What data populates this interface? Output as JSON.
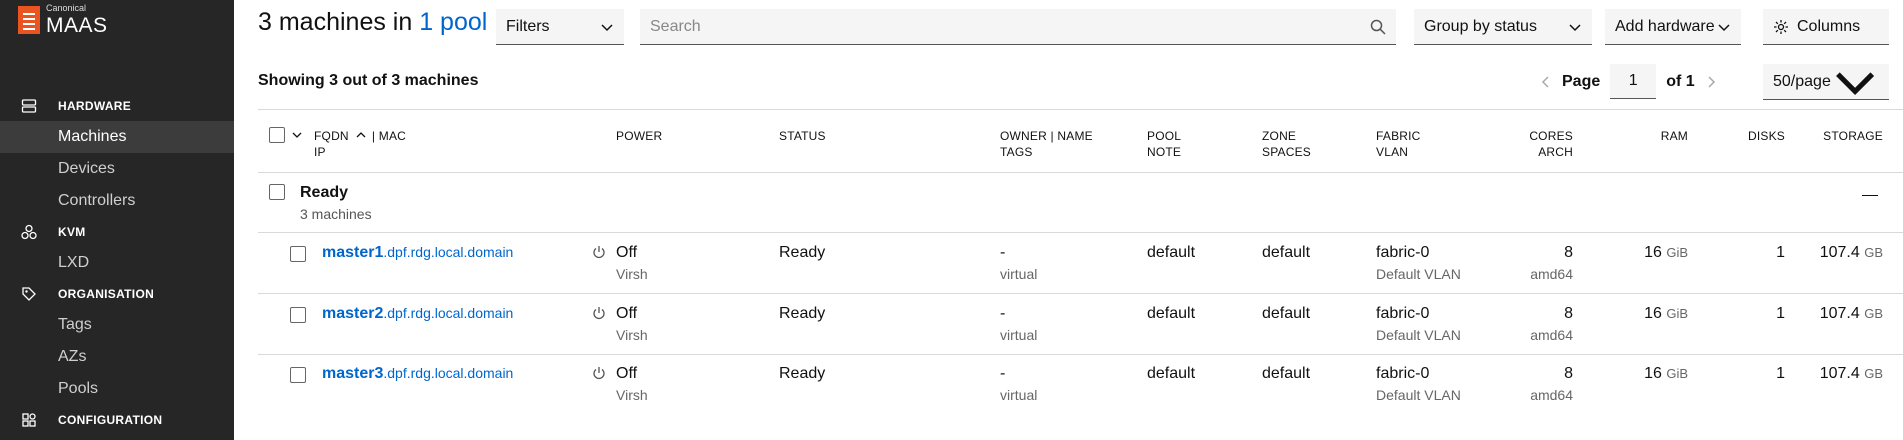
{
  "brand": {
    "small": "Canonical",
    "name": "MAAS"
  },
  "sidebar": {
    "sections": [
      {
        "heading": "HARDWARE",
        "icon": "server-icon",
        "items": [
          {
            "label": "Machines",
            "active": true
          },
          {
            "label": "Devices"
          },
          {
            "label": "Controllers"
          }
        ]
      },
      {
        "heading": "KVM",
        "icon": "kvm-icon",
        "items": [
          {
            "label": "LXD"
          }
        ]
      },
      {
        "heading": "ORGANISATION",
        "icon": "tag-icon",
        "items": [
          {
            "label": "Tags"
          },
          {
            "label": "AZs"
          },
          {
            "label": "Pools"
          }
        ]
      },
      {
        "heading": "CONFIGURATION",
        "icon": "configuration-icon",
        "items": []
      }
    ]
  },
  "header": {
    "title_prefix": "3 machines in ",
    "title_link": "1 pool",
    "filters_label": "Filters",
    "search_placeholder": "Search",
    "group_by_label": "Group by status",
    "add_hardware_label": "Add hardware",
    "columns_label": "Columns"
  },
  "summary": {
    "showing": "Showing 3 out of 3 machines",
    "page_label": "Page",
    "page_value": "1",
    "page_of": "of 1",
    "per_page": "50/page"
  },
  "table": {
    "headers": {
      "fqdn": "FQDN",
      "mac": "| MAC",
      "ip": "IP",
      "power": "POWER",
      "status": "STATUS",
      "owner": "OWNER | NAME",
      "tags": "TAGS",
      "pool": "POOL",
      "note": "NOTE",
      "zone": "ZONE",
      "spaces": "SPACES",
      "fabric": "FABRIC",
      "vlan": "VLAN",
      "cores": "CORES",
      "arch": "ARCH",
      "ram": "RAM",
      "disks": "DISKS",
      "storage": "STORAGE"
    },
    "group": {
      "title": "Ready",
      "count": "3 machines"
    },
    "rows": [
      {
        "host": "master1",
        "domain": ".dpf.rdg.local.domain",
        "power": "Off",
        "power_type": "Virsh",
        "status": "Ready",
        "owner": "-",
        "tags": "virtual",
        "pool": "default",
        "zone": "default",
        "fabric": "fabric-0",
        "vlan": "Default VLAN",
        "cores": "8",
        "arch": "amd64",
        "ram": "16",
        "ram_unit": "GiB",
        "disks": "1",
        "storage": "107.4",
        "storage_unit": "GB"
      },
      {
        "host": "master2",
        "domain": ".dpf.rdg.local.domain",
        "power": "Off",
        "power_type": "Virsh",
        "status": "Ready",
        "owner": "-",
        "tags": "virtual",
        "pool": "default",
        "zone": "default",
        "fabric": "fabric-0",
        "vlan": "Default VLAN",
        "cores": "8",
        "arch": "amd64",
        "ram": "16",
        "ram_unit": "GiB",
        "disks": "1",
        "storage": "107.4",
        "storage_unit": "GB"
      },
      {
        "host": "master3",
        "domain": ".dpf.rdg.local.domain",
        "power": "Off",
        "power_type": "Virsh",
        "status": "Ready",
        "owner": "-",
        "tags": "virtual",
        "pool": "default",
        "zone": "default",
        "fabric": "fabric-0",
        "vlan": "Default VLAN",
        "cores": "8",
        "arch": "amd64",
        "ram": "16",
        "ram_unit": "GiB",
        "disks": "1",
        "storage": "107.4",
        "storage_unit": "GB"
      }
    ]
  },
  "colors": {
    "sidebar_bg": "#262626",
    "brand_orange": "#e95420",
    "link": "#0066cc"
  }
}
